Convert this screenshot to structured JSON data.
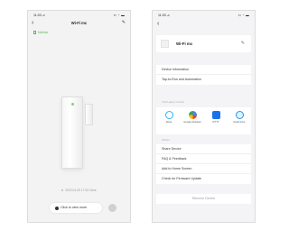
{
  "left_screen": {
    "status": {
      "time": "11:03 ⊿",
      "icons": "▪▪ ◔ ▬"
    },
    "nav": {
      "back": "‹",
      "title": "Wi-Fi mc",
      "edit": "✎"
    },
    "battery_label": "Medium",
    "record_text": "2020-04-25 17:32 Close",
    "view_more_label": "Click to view more"
  },
  "right_screen": {
    "status": {
      "time": "11:03 ⊿",
      "icons": "▪▪ ◔ ▬"
    },
    "back": "‹",
    "device": {
      "name": "Wi-Fi mc",
      "edit": "✎"
    },
    "menu_top": [
      "Device Information",
      "Tap-to-Run and Automation"
    ],
    "third_party_label": "Third-party Control",
    "services": [
      {
        "label": "Alexa",
        "color": "#29b6f6"
      },
      {
        "label": "Google Assistant",
        "color": "#ea4335"
      },
      {
        "label": "IFTTT",
        "color": "#1a73e8"
      },
      {
        "label": "Dual Home",
        "color": "#2196f3"
      }
    ],
    "others_label": "Others",
    "menu_bottom": [
      "Share Device",
      "FAQ & Feedback",
      "Add to Home Screen",
      "Check for Firmware Update"
    ],
    "remove_label": "Remove Device"
  }
}
